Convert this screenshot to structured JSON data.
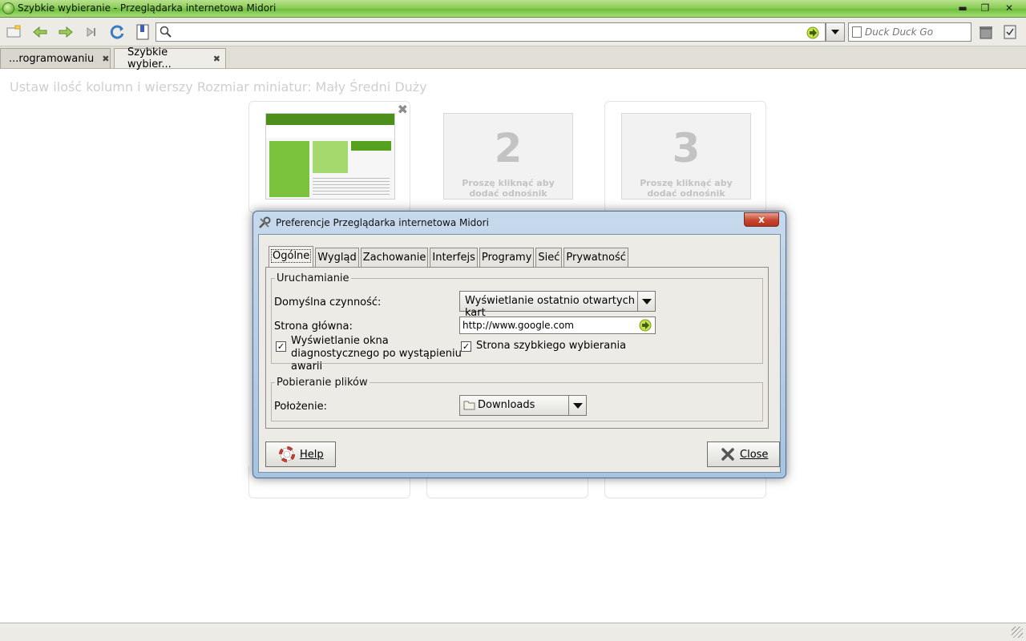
{
  "window": {
    "title": "Szybkie wybieranie - Przeglądarka internetowa Midori"
  },
  "toolbar": {
    "url_value": "",
    "search_engine": "Duck Duck Go"
  },
  "tabs": [
    {
      "label": "...rogramowaniu"
    },
    {
      "label": "Szybkie wybier..."
    }
  ],
  "speeddial": {
    "topline": "Ustaw ilość kolumn i wierszy Rozmiar miniatur: Mały Średni Duży",
    "hint": "Proszę kliknąć aby dodać odnośnik",
    "dials": [
      {
        "number": ""
      },
      {
        "number": "2"
      },
      {
        "number": "3"
      }
    ]
  },
  "dialog": {
    "title": "Preferencje Przeglądarka internetowa Midori",
    "close_glyph": "x",
    "tabs": [
      "Ogólne",
      "Wygląd",
      "Zachowanie",
      "Interfejs",
      "Programy",
      "Sieć",
      "Prywatność"
    ],
    "startup": {
      "legend": "Uruchamianie",
      "default_action_label": "Domyślna czynność:",
      "default_action_value": "Wyświetlanie ostatnio otwartych kart",
      "homepage_label": "Strona główna:",
      "homepage_value": "http://www.google.com",
      "crash_dialog_label": "Wyświetlanie okna diagnostycznego po wystąpieniu awarii",
      "speed_dial_label": "Strona szybkiego wybierania"
    },
    "downloads": {
      "legend": "Pobieranie plików",
      "location_label": "Położenie:",
      "location_value": "Downloads"
    },
    "help_label": "Help",
    "close_label": "Close"
  },
  "colors": {
    "titlebar": "#8ccf58",
    "dialog_frame": "#a7c3e1",
    "close_red": "#c8462f"
  }
}
